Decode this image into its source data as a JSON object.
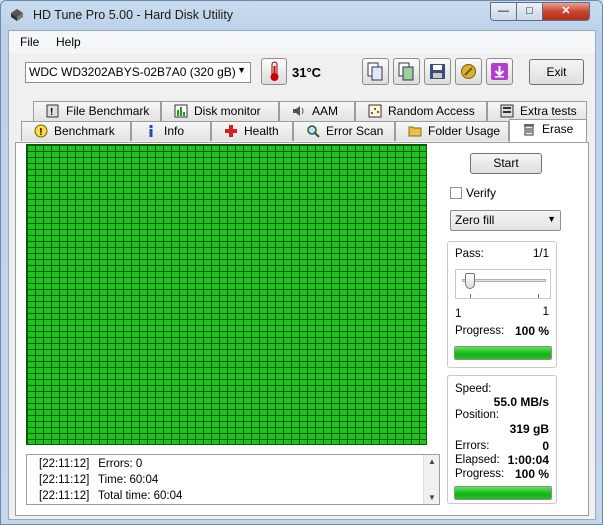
{
  "window": {
    "title": "HD Tune Pro 5.00 - Hard Disk Utility"
  },
  "menu": {
    "file": "File",
    "help": "Help"
  },
  "toolbar": {
    "drive": "WDC WD3202ABYS-02B7A0 (320 gB)",
    "temperature": "31°C",
    "exit_label": "Exit"
  },
  "tabs_top": [
    {
      "label": "File Benchmark",
      "icon": "file-benchmark-icon"
    },
    {
      "label": "Disk monitor",
      "icon": "disk-monitor-icon"
    },
    {
      "label": "AAM",
      "icon": "speaker-icon"
    },
    {
      "label": "Random Access",
      "icon": "random-access-icon"
    },
    {
      "label": "Extra tests",
      "icon": "extra-tests-icon"
    }
  ],
  "tabs_bottom": [
    {
      "label": "Benchmark",
      "icon": "benchmark-icon"
    },
    {
      "label": "Info",
      "icon": "info-icon"
    },
    {
      "label": "Health",
      "icon": "health-cross-icon"
    },
    {
      "label": "Error Scan",
      "icon": "magnifier-icon"
    },
    {
      "label": "Folder Usage",
      "icon": "folder-icon"
    },
    {
      "label": "Erase",
      "icon": "trash-icon"
    }
  ],
  "active_tab": "Erase",
  "log": [
    {
      "time": "[22:11:12]",
      "text": "Errors: 0"
    },
    {
      "time": "[22:11:12]",
      "text": "Time: 60:04"
    },
    {
      "time": "[22:11:12]",
      "text": "Total time: 60:04"
    }
  ],
  "side": {
    "start_label": "Start",
    "verify_label": "Verify",
    "verify_checked": false,
    "method": "Zero fill",
    "pass_label": "Pass:",
    "pass_value": "1/1",
    "slider_min": "1",
    "slider_max": "1",
    "progress_label": "Progress:",
    "pass_progress": "100 %",
    "pass_progress_fraction": 1.0,
    "speed_label": "Speed:",
    "speed_value": "55.0 MB/s",
    "position_label": "Position:",
    "position_value": "319 gB",
    "errors_label": "Errors:",
    "errors_value": "0",
    "elapsed_label": "Elapsed:",
    "elapsed_value": "1:00:04",
    "total_progress_label": "Progress:",
    "total_progress": "100 %",
    "total_progress_fraction": 1.0
  },
  "colors": {
    "grid_ok": "#1ec31e",
    "grid_line": "#0b5a0b",
    "progress": "#12b312"
  }
}
